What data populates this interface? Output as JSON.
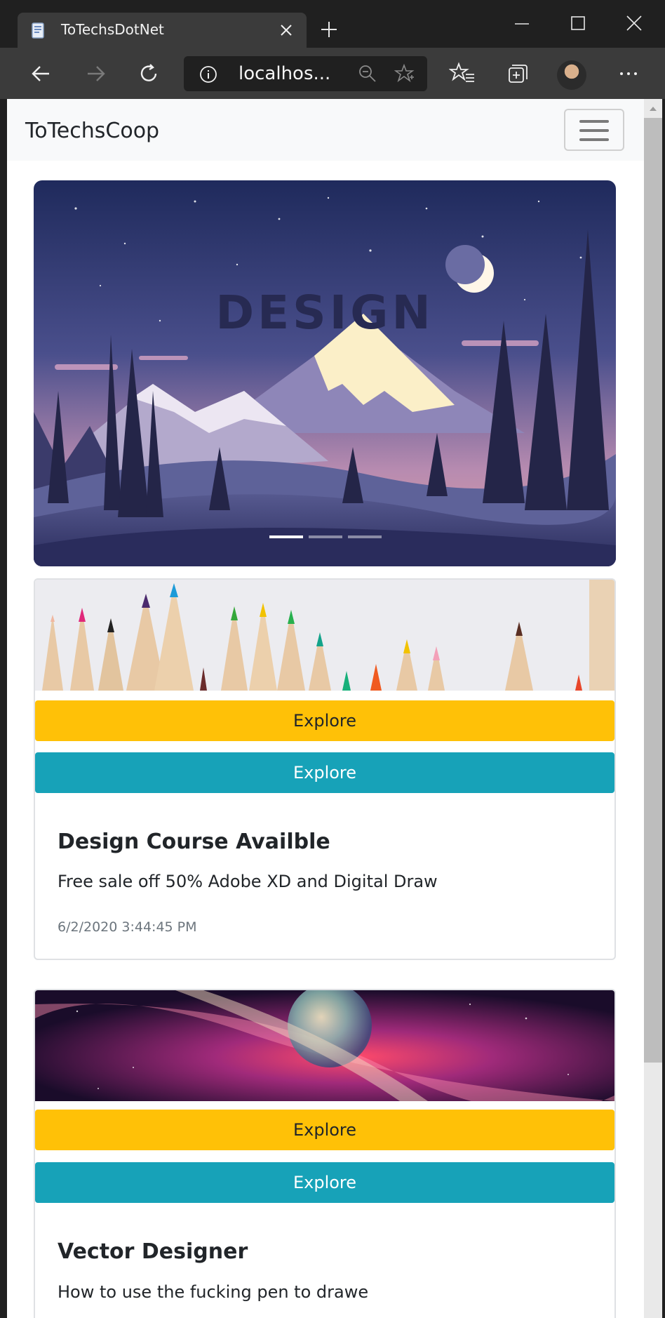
{
  "browser": {
    "tab_title": "ToTechsDotNet",
    "url": "localhos..."
  },
  "navbar": {
    "brand": "ToTechsCoop"
  },
  "carousel": {
    "caption": "DESIGN",
    "slide_count": 3,
    "active_index": 0
  },
  "cards": [
    {
      "primary_button": "Explore",
      "secondary_button": "Explore",
      "title": "Design Course Availble",
      "text": "Free sale off 50% Adobe XD and Digital Draw",
      "date": "6/2/2020 3:44:45 PM"
    },
    {
      "primary_button": "Explore",
      "secondary_button": "Explore",
      "title": "Vector Designer",
      "text": "How to use the fucking pen to drawe"
    }
  ],
  "colors": {
    "button_warning": "#ffc107",
    "button_info": "#17a2b8",
    "navbar_bg": "#f8f9fa"
  }
}
